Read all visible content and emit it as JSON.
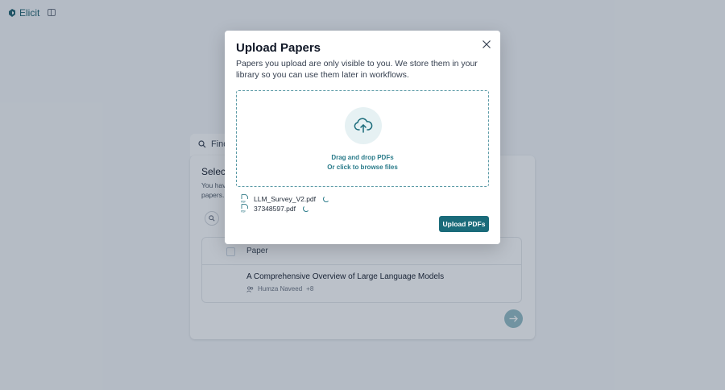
{
  "app": {
    "name": "Elicit"
  },
  "background": {
    "search_label": "Find",
    "card_title": "Selec",
    "card_desc": "You hav",
    "card_desc2": "papers.",
    "table": {
      "header": "Paper",
      "rows": [
        {
          "title": "A Comprehensive Overview of Large Language Models",
          "author": "Humza Naveed",
          "more": "+8"
        }
      ]
    }
  },
  "modal": {
    "title": "Upload Papers",
    "description": "Papers you upload are only visible to you. We store them in your library so you can use them later in workflows.",
    "drop_line1": "Drag and drop PDFs",
    "drop_line2": "Or click to browse files",
    "files": [
      "LLM_Survey_V2.pdf",
      "37348597.pdf"
    ],
    "upload_label": "Upload PDFs"
  },
  "colors": {
    "accent": "#1a6b7a",
    "overlay": "rgba(45,62,86,0.32)"
  }
}
